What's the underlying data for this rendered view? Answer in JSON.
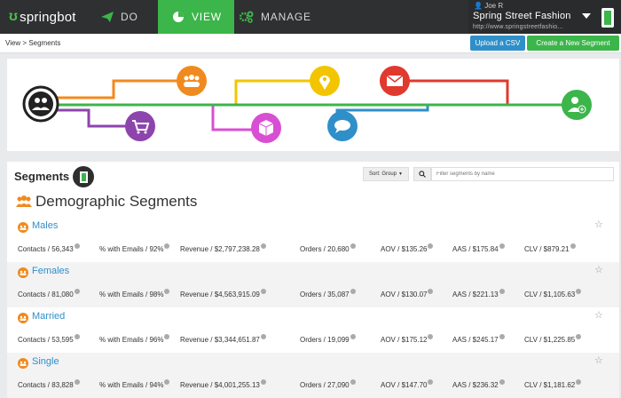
{
  "nav": {
    "brand": "springbot",
    "tabs": [
      {
        "label": "DO"
      },
      {
        "label": "VIEW"
      },
      {
        "label": "MANAGE"
      }
    ],
    "user": "Joe R",
    "store_name": "Spring Street Fashion",
    "store_url": "http://www.springstreetfashio..."
  },
  "breadcrumb": "View > Segments",
  "actions": {
    "upload": "Upload a CSV",
    "create": "Create a New Segment"
  },
  "banner_colors": [
    "#f08a1e",
    "#f2c500",
    "#e0392d",
    "#3cb54a",
    "#8e44ad",
    "#d94fd3",
    "#2f8fc9"
  ],
  "panel": {
    "title": "Segments",
    "sort_label": "Sort: Group",
    "search_placeholder": "Filter segments by name",
    "section_title": "Demographic Segments"
  },
  "segments": [
    {
      "name": "Males",
      "contacts": "Contacts / 56,343",
      "emails": "% with Emails / 92%",
      "revenue": "Revenue / $2,797,238.28",
      "orders": "Orders / 20,680",
      "aov": "AOV / $135.26",
      "aas": "AAS / $175.84",
      "clv": "CLV / $879.21"
    },
    {
      "name": "Females",
      "contacts": "Contacts / 81,080",
      "emails": "% with Emails / 98%",
      "revenue": "Revenue / $4,563,915.09",
      "orders": "Orders / 35,087",
      "aov": "AOV / $130.07",
      "aas": "AAS / $221.13",
      "clv": "CLV / $1,105.63"
    },
    {
      "name": "Married",
      "contacts": "Contacts / 53,595",
      "emails": "% with Emails / 96%",
      "revenue": "Revenue / $3,344,651.87",
      "orders": "Orders / 19,099",
      "aov": "AOV / $175.12",
      "aas": "AAS / $245.17",
      "clv": "CLV / $1,225.85"
    },
    {
      "name": "Single",
      "contacts": "Contacts / 83,828",
      "emails": "% with Emails / 94%",
      "revenue": "Revenue / $4,001,255.13",
      "orders": "Orders / 27,090",
      "aov": "AOV / $147.70",
      "aas": "AAS / $236.32",
      "clv": "CLV / $1,181.62"
    }
  ]
}
